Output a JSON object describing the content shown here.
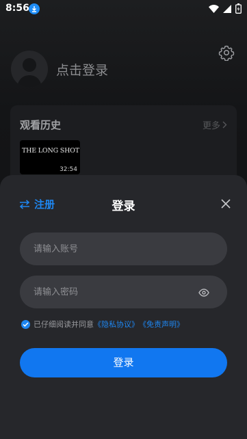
{
  "status_bar": {
    "time": "8:56"
  },
  "profile": {
    "login_prompt": "点击登录"
  },
  "history": {
    "title": "观看历史",
    "more_label": "更多",
    "items": [
      {
        "title": "THE LONG SHOT",
        "duration": "32:54"
      }
    ]
  },
  "login_sheet": {
    "register_label": "注册",
    "title": "登录",
    "account_placeholder": "请输入账号",
    "password_placeholder": "请输入密码",
    "agreement_prefix": "已仔细阅读并同意",
    "privacy_link": "《隐私协议》",
    "disclaimer_link": "《免责声明》",
    "login_button": "登录"
  },
  "colors": {
    "accent": "#1177f0",
    "sheet_bg": "#26272b",
    "field_bg": "#3a3b40"
  }
}
